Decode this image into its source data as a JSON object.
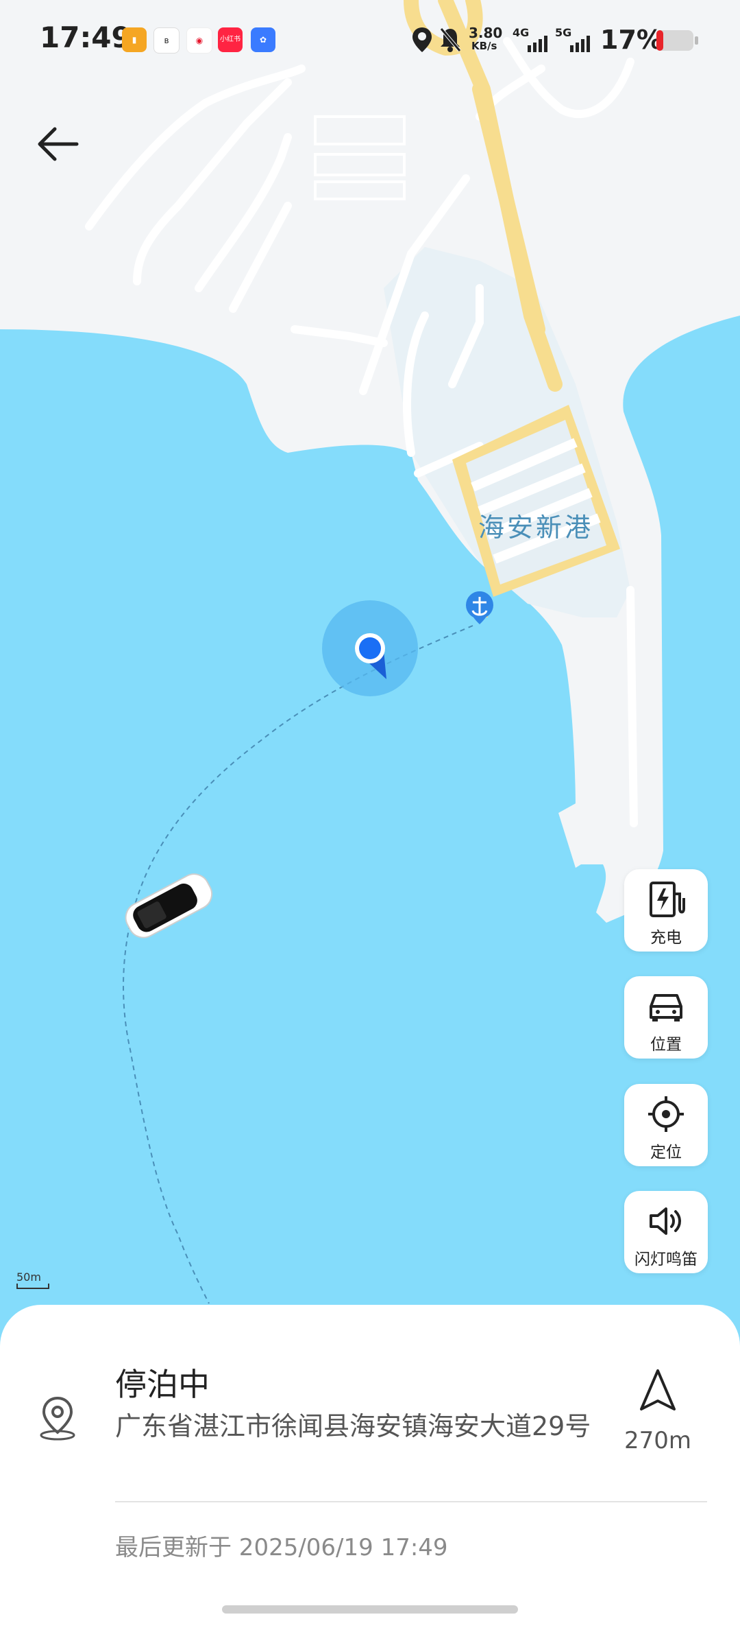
{
  "status_bar": {
    "time": "17:49",
    "net_speed_value": "3.80",
    "net_speed_unit": "KB/s",
    "net1": "4G",
    "net2": "5G",
    "battery": "17%",
    "app_icons": [
      "notes-app-icon",
      "bluetooth-icon",
      "weibo-icon",
      "xiaohongshu-icon",
      "baidu-map-icon"
    ],
    "app_icon_text": "小红书"
  },
  "map": {
    "place_label": "海安新港"
  },
  "side_actions": [
    {
      "label": "充电",
      "icon": "charging-station-icon"
    },
    {
      "label": "位置",
      "icon": "car-icon"
    },
    {
      "label": "定位",
      "icon": "locate-target-icon"
    },
    {
      "label": "闪灯鸣笛",
      "icon": "speaker-horn-icon"
    }
  ],
  "scale_label": "50m",
  "panel": {
    "status": "停泊中",
    "address": "广东省湛江市徐闻县海安镇海安大道29号",
    "distance": "270m",
    "updated": "最后更新于 2025/06/19 17:49"
  },
  "colors": {
    "water": "#84dcfb",
    "land": "#f3f5f7",
    "road": "#f7dd8f",
    "accent": "#1a6ff5"
  }
}
